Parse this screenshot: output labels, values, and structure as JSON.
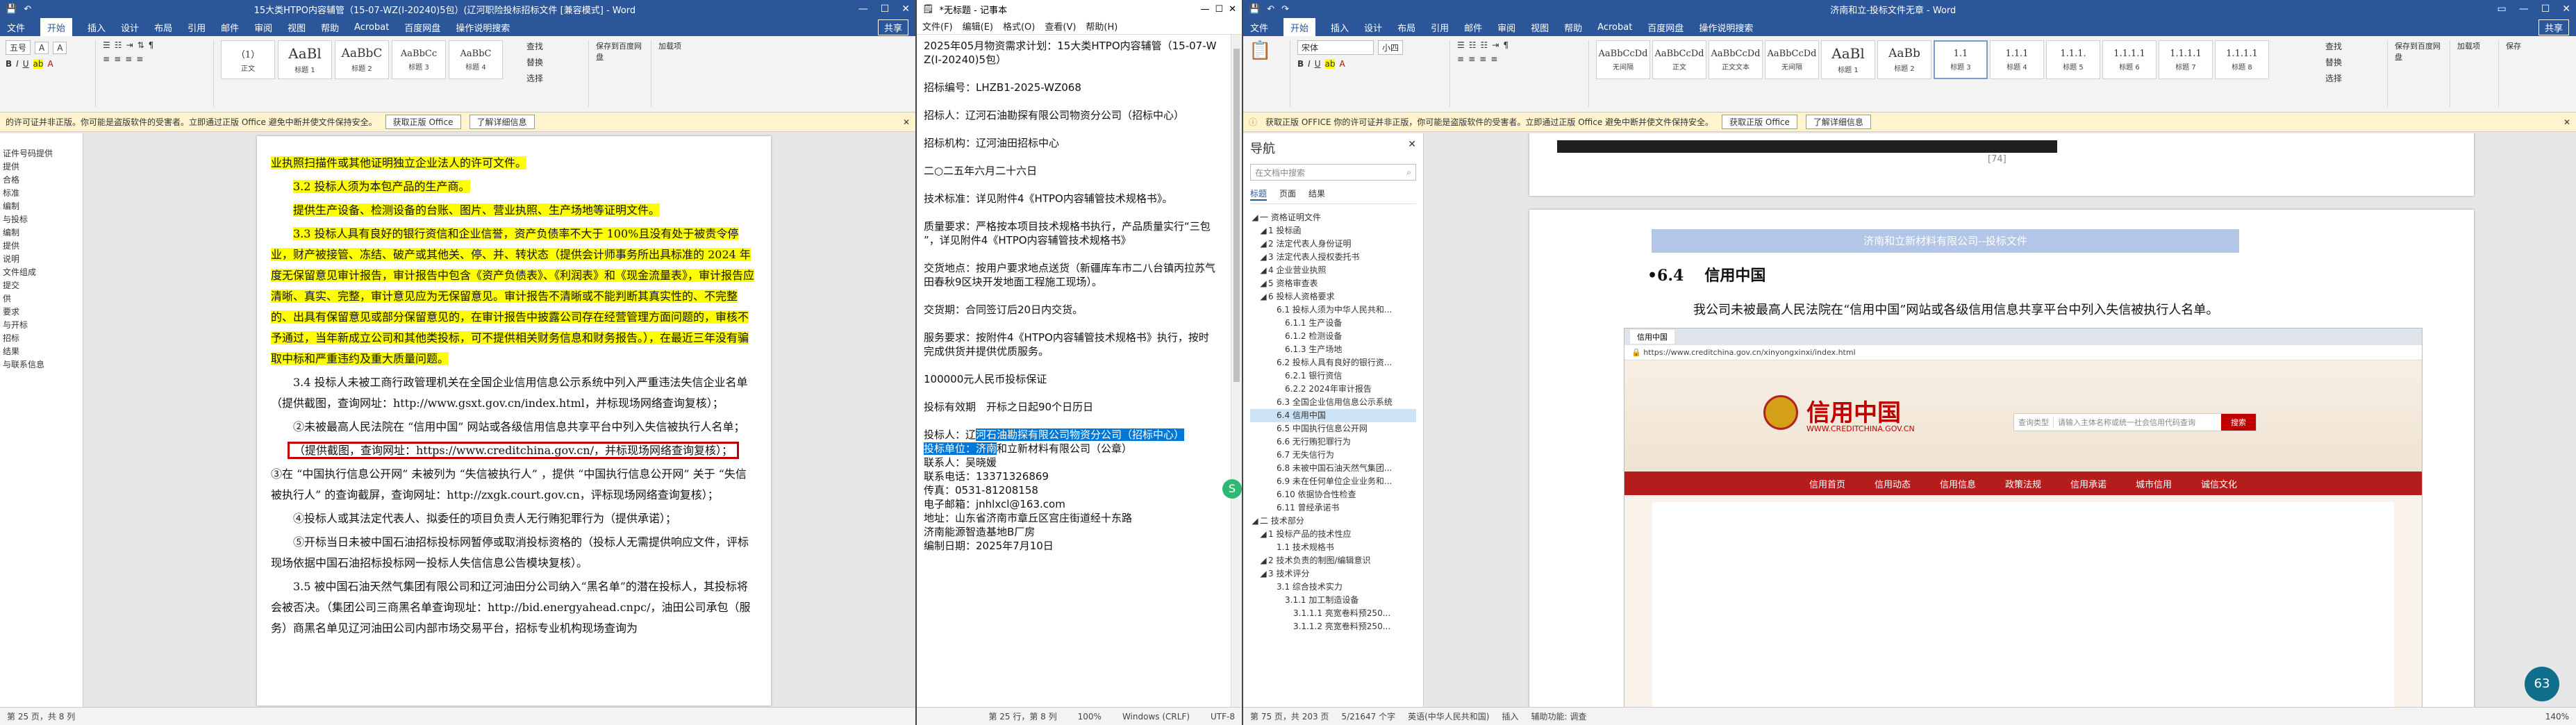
{
  "left_word": {
    "title": "15大类HTPO内容辅管（15-07-WZ(I-20240)5包）(辽河职险投标招标文件 [兼容模式] - Word",
    "share": "共享",
    "tabs": [
      "文件",
      "开始",
      "插入",
      "设计",
      "布局",
      "引用",
      "邮件",
      "审阅",
      "视图",
      "帮助",
      "Acrobat",
      "百度网盘",
      "操作说明搜索"
    ],
    "font_size": "五号",
    "styles": [
      {
        "preview": "（1）",
        "name": "正文"
      },
      {
        "preview": "AaBl",
        "name": "标题 1"
      },
      {
        "preview": "AaBbC",
        "name": "标题 2"
      },
      {
        "preview": "AaBbCc",
        "name": "标题 3"
      },
      {
        "preview": "AaBbC",
        "name": "标题 4"
      }
    ],
    "right_buttons": [
      "查找",
      "替换",
      "选择",
      "保存到百度网盘",
      "加载项"
    ],
    "message": "的许可证并非正版。你可能是盗版软件的受害者。立即通过正版 Office 避免中断并使文件保持安全。",
    "msg_btn1": "获取正版 Office",
    "msg_btn2": "了解详细信息",
    "nav_fragments": [
      "证件号码提供",
      "提供",
      "合格",
      "标准",
      "编制",
      "与投标",
      "编制",
      "提供",
      "说明",
      "文件组成",
      "提交",
      "供",
      "要求",
      "与开标",
      "招标",
      "结果",
      "与联系信息"
    ],
    "doc": {
      "p1": "业执照扫描件或其他证明独立企业法人的许可文件。",
      "p2": "3.2 投标人须为本包产品的生产商。",
      "p3": "提供生产设备、检测设备的台账、图片、营业执照、生产场地等证明文件。",
      "p4": "3.3 投标人具有良好的银行资信和企业信誉，资产负债率不大于 100%且没有处于被责令停业，财产被接管、冻结、破产或其他关、停、并、转状态（提供会计师事务所出具标准的 2024 年度无保留意见审计报告，审计报告中包含《资产负债表》、《利润表》和《现金流量表》，审计报告应清晰、真实、完整，审计意见应为无保留意见。审计报告不清晰或不能判断其真实性的、不完整的、出具有保留意见或部分保留意见的，在审计报告中披露公司存在经营管理方面问题的，审核不予通过，当年新成立公司和其他类投标，可不提供相关财务信息和财务报告。），在最近三年没有骗取中标和严重违约及重大质量问题。",
      "p5": "3.4 投标人未被工商行政管理机关在全国企业信用信息公示系统中列入严重违法失信企业名单（提供截图，查询网址：http://www.gsxt.gov.cn/index.html，并标现场网络查询复核）；",
      "p6": "②未被最高人民法院在 “信用中国” 网站或各级信用信息共享平台中列入失信被执行人名单；",
      "p7": "（提供截图，查询网址：https://www.creditchina.gov.cn/，并标现场网络查询复核）；",
      "p8": "③在 “中国执行信息公开网” 未被列为 “失信被执行人” ，提供 “中国执行信息公开网” 关于 “失信被执行人” 的查询截屏，查询网址：http://zxgk.court.gov.cn，评标现场网络查询复核）；",
      "p9": "④投标人或其法定代表人、拟委任的项目负责人无行贿犯罪行为（提供承诺）；",
      "p10": "⑤开标当日未被中国石油招标投标网暂停或取消投标资格的（投标人无需提供响应文件，评标现场依据中国石油招标投标网一投标人失信信息公告模块复核）。",
      "p11": "3.5 被中国石油天然气集团有限公司和辽河油田分公司纳入“黑名单”的潜在投标人，其投标将会被否决。（集团公司三商黑名单查询现址：http://bid.energyahead.cnpc/，油田公司承包（服务）商黑名单见辽河油田公司内部市场交易平台，招标专业机构现场查询为"
    },
    "status": "第 25 页，共 8 列"
  },
  "notepad": {
    "title": "*无标题 - 记事本",
    "menu": [
      "文件(F)",
      "编辑(E)",
      "格式(O)",
      "查看(V)",
      "帮助(H)"
    ],
    "lines": [
      "2025年05月物资需求计划：15大类HTPO内容辅管（15-07-W",
      "Z(I-20240)5包）",
      "",
      "招标编号：LHZB1-2025-WZ068",
      "",
      "招标人：辽河石油勘探有限公司物资分公司（招标中心）",
      "",
      "招标机构：辽河油田招标中心",
      "",
      "二○二五年六月二十六日",
      "",
      "技术标准：详见附件4《HTPO内容辅管技术规格书》。",
      "",
      "质量要求：严格按本项目技术规格书执行，产品质量实行“三包",
      "”，详见附件4《HTPO内容辅管技术规格书》",
      "",
      "交货地点：按用户要求地点送货（新疆库车市二八台镇丙拉苏气",
      "田春秋9区块开发地面工程施工现场）。",
      "",
      "交货期：合同签订后20日内交货。",
      "",
      "服务要求：按附件4《HTPO内容辅管技术规格书》执行，按时",
      "完成供货并提供优质服务。",
      "",
      "100000元人民币投标保证",
      "",
      "投标有效期　开标之日起90个日历日",
      ""
    ],
    "sel_line1_pre": "投标人：辽",
    "sel_line1_sel": "河石油勘探有限公司物资分公司（招标中心）",
    "sel_line2_sel": "投标单位：济南",
    "sel_line2_post": "和立新材料有限公司（公章）",
    "tail_lines": [
      "联系人：吴晓媛",
      "联系电话：13371326869",
      "传真：0531-81208158",
      "电子邮箱：jnhlxcl@163.com",
      "地址：山东省济南市章丘区宫庄街道经十东路",
      "济南能源智造基地B厂房",
      "编制日期：2025年7月10日"
    ],
    "status": [
      "第 25 行，第 8 列",
      "100%",
      "Windows (CRLF)",
      "UTF-8"
    ]
  },
  "right_word": {
    "title": "济南和立-投标文件无章 - Word",
    "share": "共享",
    "tabs": [
      "文件",
      "开始",
      "插入",
      "设计",
      "布局",
      "引用",
      "邮件",
      "审阅",
      "视图",
      "帮助",
      "Acrobat",
      "百度网盘",
      "操作说明搜索"
    ],
    "font": "宋体",
    "font_size": "小四",
    "styles": [
      {
        "preview": "AaBbCcDd",
        "name": "无间隔"
      },
      {
        "preview": "AaBbCcDd",
        "name": "正文"
      },
      {
        "preview": "AaBbCcDd",
        "name": "正文文本"
      },
      {
        "preview": "AaBbCcDd",
        "name": "无间隔"
      },
      {
        "preview": "AaBl",
        "name": "标题 1"
      },
      {
        "preview": "AaBb",
        "name": "标题 2"
      },
      {
        "preview": "1.1",
        "name": "标题 3"
      },
      {
        "preview": "1.1.1",
        "name": "标题 4"
      },
      {
        "preview": "1.1.1.",
        "name": "标题 5"
      },
      {
        "preview": "1.1.1.1",
        "name": "标题 6"
      },
      {
        "preview": "1.1.1.1",
        "name": "标题 7"
      },
      {
        "preview": "1.1.1.1",
        "name": "标题 8"
      }
    ],
    "right_buttons": [
      "查找",
      "替换",
      "选择",
      "保存到百度网盘",
      "加载项",
      "保存"
    ],
    "message": "获取正版 OFFICE  你的许可证并非正版，你可能是盗版软件的受害者。立即通过正版 Office 避免中断并使文件保持安全。",
    "msg_btn1": "获取正版 Office",
    "msg_btn2": "了解详细信息",
    "nav": {
      "title": "导航",
      "search_placeholder": "在文档中搜索",
      "tabs": [
        "标题",
        "页面",
        "结果"
      ],
      "items": [
        {
          "label": "一  资格证明文件",
          "indent": 0
        },
        {
          "label": "1 投标函",
          "indent": 1
        },
        {
          "label": "2 法定代表人身份证明",
          "indent": 1
        },
        {
          "label": "3 法定代表人授权委托书",
          "indent": 1
        },
        {
          "label": "4 企业营业执照",
          "indent": 1
        },
        {
          "label": "5 资格审查表",
          "indent": 1
        },
        {
          "label": "6 投标人资格要求",
          "indent": 1
        },
        {
          "label": "6.1 投标人须为中华人民共和...",
          "indent": 2
        },
        {
          "label": "6.1.1 生产设备",
          "indent": 3
        },
        {
          "label": "6.1.2 检测设备",
          "indent": 3
        },
        {
          "label": "6.1.3 生产场地",
          "indent": 3
        },
        {
          "label": "6.2 投标人具有良好的银行资...",
          "indent": 2
        },
        {
          "label": "6.2.1 银行资信",
          "indent": 3
        },
        {
          "label": "6.2.2 2024年审计报告",
          "indent": 3
        },
        {
          "label": "6.3 全国企业信用信息公示系统",
          "indent": 2
        },
        {
          "label": "6.4 信用中国",
          "indent": 2,
          "sel": true
        },
        {
          "label": "6.5 中国执行信息公开网",
          "indent": 2
        },
        {
          "label": "6.6 无行贿犯罪行为",
          "indent": 2
        },
        {
          "label": "6.7 无失信行为",
          "indent": 2
        },
        {
          "label": "6.8 未被中国石油天然气集团...",
          "indent": 2
        },
        {
          "label": "6.9 未在任何单位企业业务和...",
          "indent": 2
        },
        {
          "label": "6.10 依据协合性检查",
          "indent": 2
        },
        {
          "label": "6.11 曾经承诺书",
          "indent": 2
        },
        {
          "label": "二  技术部分",
          "indent": 0
        },
        {
          "label": "1 投标产品的技术性应",
          "indent": 1
        },
        {
          "label": "1.1 技术规格书",
          "indent": 2
        },
        {
          "label": "2 技术负责的制图/编辑意识",
          "indent": 1
        },
        {
          "label": "3 技术评分",
          "indent": 1
        },
        {
          "label": "3.1 综合技术实力",
          "indent": 2
        },
        {
          "label": "3.1.1 加工制造设备",
          "indent": 3
        },
        {
          "label": "3.1.1.1 亮宽卷料预250...",
          "indent": 4
        },
        {
          "label": "3.1.1.2 亮宽卷料预250...",
          "indent": 4
        }
      ]
    },
    "doc": {
      "page_num": "[74]",
      "header_band": "济南和立新材料有限公司--投标文件",
      "heading_num": "•6.4",
      "heading_text": "信用中国",
      "body": "我公司未被最高人民法院在“信用中国”网站或各级信用信息共享平台中列入失信被执行人名单。",
      "screenshot": {
        "tab": "信用中国",
        "url": "https://www.creditchina.gov.cn/xinyongxinxi/index.html",
        "logo_text": "信用中国",
        "logo_sub": "WWW.CREDITCHINA.GOV.CN",
        "search_type": "查询类型",
        "search_placeholder": "请输入主体名称或统一社会信用代码查询",
        "search_btn": "搜索",
        "menu": [
          "信用首页",
          "信用动态",
          "信用信息",
          "政策法规",
          "信用承诺",
          "城市信用",
          "诚信文化"
        ]
      }
    },
    "status": [
      "第 75 页，共 203 页",
      "5/21647 个字",
      "英语(中华人民共和国)",
      "插入",
      "辅助功能: 调查"
    ],
    "zoom": "140%"
  },
  "taskbar": {
    "badge": "63"
  }
}
